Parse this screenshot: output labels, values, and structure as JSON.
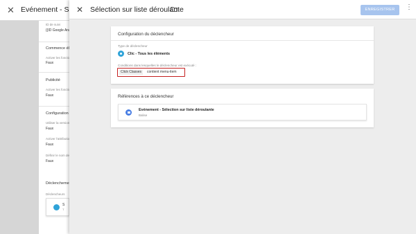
{
  "background": {
    "close_icon": "close-icon",
    "title": "Evénement - Sélection sur liste déroulante",
    "fields": [
      {
        "label": "ID de suivi",
        "value": "{{ID Google Analytics}}"
      },
      {
        "section": "Commence élément"
      },
      {
        "label": "Activer les fonctions",
        "value": "Faux"
      },
      {
        "section": "Publicité"
      },
      {
        "label": "Activer les fonctions",
        "value": "Faux"
      },
      {
        "section": "Configuration"
      },
      {
        "label": "Utiliser la version",
        "value": "Faux"
      },
      {
        "label": "Activer l'attribution",
        "value": "Faux"
      },
      {
        "label": "Définir le nom de",
        "value": "Faux"
      }
    ],
    "triggers_heading": "Déclencheme",
    "triggers_label": "Déclencheurs",
    "trigger_chip": {
      "title": "S",
      "sub": "T"
    }
  },
  "panel": {
    "title": "Sélection sur liste déroulante",
    "save_label": "ENREGISTRER",
    "more_icon": "more-vert-icon",
    "folder_icon": "folder-icon",
    "config": {
      "heading": "Configuration du déclencheur",
      "type_label": "Type de déclencheur",
      "type_value": "Clic - Tous les éléments",
      "conditions_label": "Conditions dans lesquelles le déclencheur est exécuté :",
      "condition_variable": "Click Classes",
      "condition_operator_value": "contient  menu-item"
    },
    "references": {
      "heading": "Références à ce déclencheur",
      "item_title": "Evénement - Sélection sur liste déroulante",
      "item_sub": "Balise"
    }
  }
}
